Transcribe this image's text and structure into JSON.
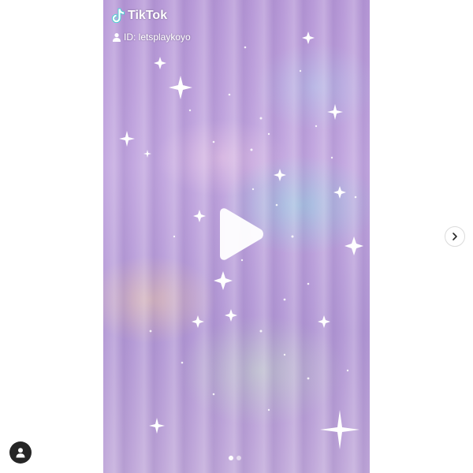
{
  "overlay": {
    "brand": "TikTok",
    "user_id": "ID: letsplaykoyo"
  },
  "carousel": {
    "slide_count": 2,
    "active_slide": 1
  },
  "icons": {
    "logo": "tiktok-note-icon",
    "user": "user-icon",
    "play": "play-icon",
    "next": "chevron-right-icon",
    "tags": "person-tag-icon"
  },
  "colors": {
    "background": "#ffffff",
    "video_tint": "#b89ad8",
    "play_fill": "#ffffff",
    "tag_button_bg": "#262626"
  }
}
